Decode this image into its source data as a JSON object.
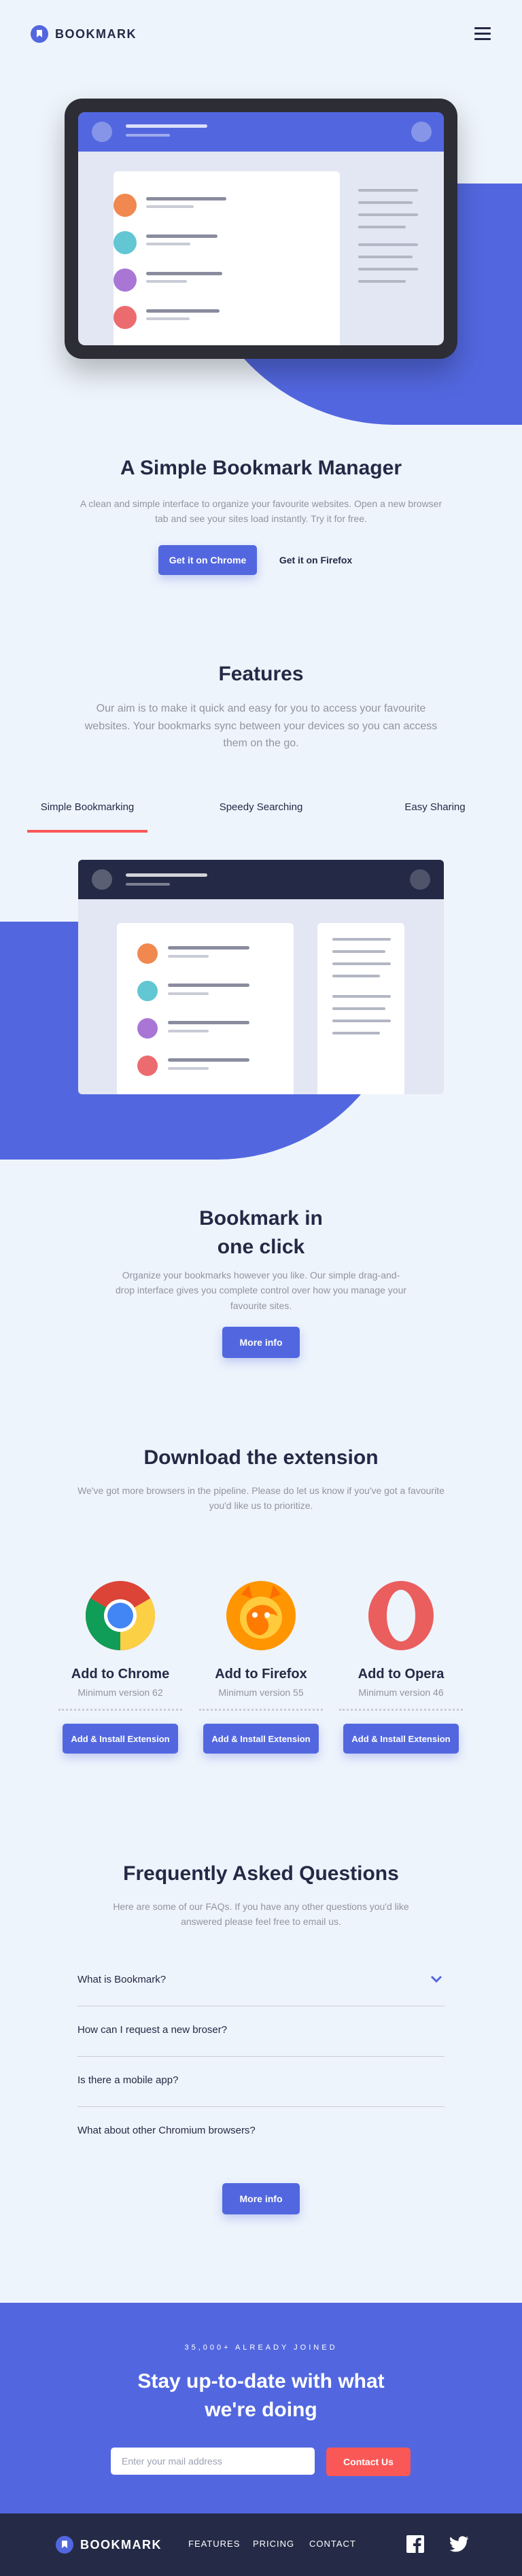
{
  "brand": {
    "name": "BOOKMARK",
    "accent": "#5267df",
    "danger": "#fa5757",
    "dark": "#242a45"
  },
  "header": {
    "menu_icon": "hamburger-icon"
  },
  "hero": {
    "title": "A Simple Bookmark Manager",
    "description": "A clean and simple interface to organize your favourite websites. Open a new browser tab and see your sites load instantly. Try it for free.",
    "primary_button": "Get it on Chrome",
    "secondary_button": "Get it on Firefox"
  },
  "features": {
    "title": "Features",
    "description": "Our aim is to make it quick and easy for you to access your favourite websites. Your bookmarks sync between your devices so you can access them on the go.",
    "tabs": [
      {
        "label": "Simple Bookmarking"
      },
      {
        "label": "Speedy Searching"
      },
      {
        "label": "Easy Sharing"
      }
    ],
    "active_tab": "Simple Bookmarking",
    "panel_title": "Bookmark in one click",
    "panel_title_line1": "Bookmark in",
    "panel_title_line2": "one click",
    "panel_description": "Organize your bookmarks however you like. Our simple drag-and-drop interface gives you complete control over how you manage your favourite sites.",
    "panel_button": "More info"
  },
  "download": {
    "title": "Download the extension",
    "description": "We've got more browsers in the pipeline. Please do let us know if you've got a favourite you'd like us to prioritize.",
    "extensions": [
      {
        "name": "Add to Chrome",
        "min_version": "Minimum version 62",
        "button": "Add & Install Extension",
        "icon": "chrome-logo"
      },
      {
        "name": "Add to Firefox",
        "min_version": "Minimum version 55",
        "button": "Add & Install Extension",
        "icon": "firefox-logo"
      },
      {
        "name": "Add to Opera",
        "min_version": "Minimum version 46",
        "button": "Add & Install Extension",
        "icon": "opera-logo"
      }
    ]
  },
  "faq": {
    "title": "Frequently Asked Questions",
    "description": "Here are some of our FAQs. If you have any other questions you'd like answered please feel free to email us.",
    "items": [
      {
        "question": "What is Bookmark?"
      },
      {
        "question": "How can I request a new broser?"
      },
      {
        "question": "Is there a mobile app?"
      },
      {
        "question": "What about other Chromium browsers?"
      }
    ],
    "button": "More info"
  },
  "cta": {
    "kicker": "35,000+ ALREADY JOINED",
    "title": "Stay up-to-date with what we're doing",
    "email_placeholder": "Enter your mail address",
    "button": "Contact Us"
  },
  "footer": {
    "brand": "BOOKMARK",
    "links": [
      "FEATURES",
      "PRICING",
      "CONTACT"
    ],
    "social": [
      "facebook-icon",
      "twitter-icon"
    ]
  }
}
